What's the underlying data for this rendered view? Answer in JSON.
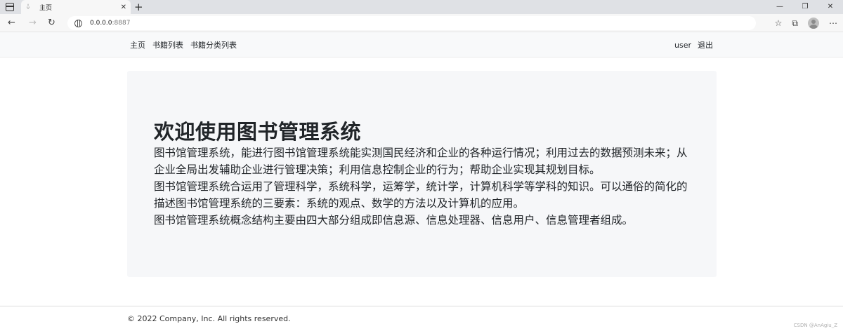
{
  "browser": {
    "tab_title": "主页",
    "url_host": "0.0.0.0",
    "url_port": ":8887"
  },
  "nav": {
    "items": [
      "主页",
      "书籍列表",
      "书籍分类列表"
    ],
    "user": "user",
    "logout": "退出"
  },
  "hero": {
    "title": "欢迎使用图书管理系统",
    "lines": [
      "图书馆管理系统，能进行图书馆管理系统能实测国民经济和企业的各种运行情况；利用过去的数据预测未来；从",
      "企业全局出发辅助企业进行管理决策；利用信息控制企业的行为；帮助企业实现其规划目标。",
      "图书馆管理系统合运用了管理科学，系统科学，运筹学，统计学，计算机科学等学科的知识。可以通俗的简化的",
      "描述图书馆管理系统的三要素：系统的观点、数学的方法以及计算机的应用。",
      "图书馆管理系统概念结构主要由四大部分组成即信息源、信息处理器、信息用户、信息管理者组成。"
    ]
  },
  "footer": {
    "copyright": "© 2022 Company, Inc. All rights reserved."
  },
  "watermark": "CSDN @AnAgiu_Z"
}
